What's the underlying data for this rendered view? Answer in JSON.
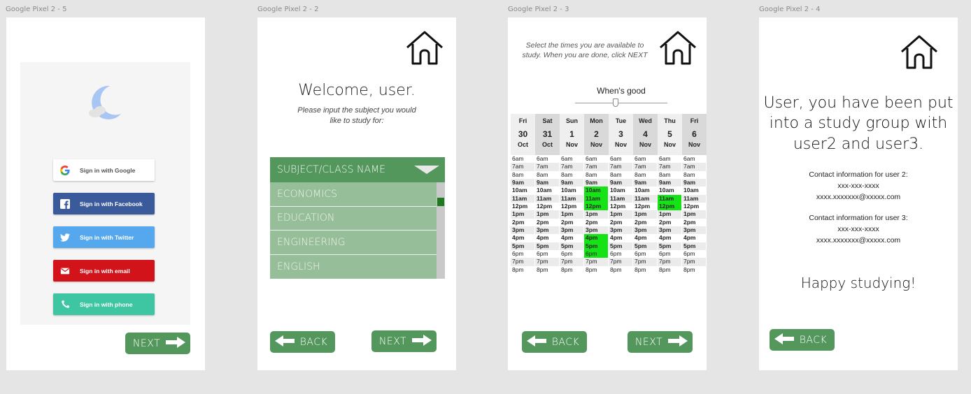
{
  "frames": [
    {
      "label": "Google Pixel 2 - 5"
    },
    {
      "label": "Google Pixel 2 - 2"
    },
    {
      "label": "Google Pixel 2 - 3"
    },
    {
      "label": "Google Pixel 2 - 4"
    }
  ],
  "login": {
    "buttons": [
      {
        "label": "Sign in with Google",
        "icon": "google-icon",
        "color": "#ffffff"
      },
      {
        "label": "Sign in with Facebook",
        "icon": "facebook-icon",
        "color": "#3b5a9b"
      },
      {
        "label": "Sign in with Twitter",
        "icon": "twitter-icon",
        "color": "#56a8ee"
      },
      {
        "label": "Sign in with email",
        "icon": "email-icon",
        "color": "#d2141a"
      },
      {
        "label": "Sign in with phone",
        "icon": "phone-icon",
        "color": "#3ec5a2"
      }
    ],
    "next_label": "NEXT"
  },
  "subject": {
    "title": "Welcome, user.",
    "subtitle": "Please input the subject you would like to study for:",
    "dropdown_selected": "SUBJECT/CLASS NAME",
    "options": [
      "ECONOMICS",
      "EDUCATION",
      "ENGINEERING",
      "ENGLISH"
    ],
    "back_label": "BACK",
    "next_label": "NEXT"
  },
  "schedule": {
    "instructions": "Select the times you are available to study. When you are done, click NEXT",
    "slider_label": "When's good",
    "days": [
      {
        "day": "Fri",
        "num": "30",
        "month": "Oct"
      },
      {
        "day": "Sat",
        "num": "31",
        "month": "Oct"
      },
      {
        "day": "Sun",
        "num": "1",
        "month": "Nov"
      },
      {
        "day": "Mon",
        "num": "2",
        "month": "Nov"
      },
      {
        "day": "Tue",
        "num": "3",
        "month": "Nov"
      },
      {
        "day": "Wed",
        "num": "4",
        "month": "Nov"
      },
      {
        "day": "Thu",
        "num": "5",
        "month": "Nov"
      },
      {
        "day": "Fri",
        "num": "6",
        "month": "Nov"
      }
    ],
    "times": [
      "6am",
      "7am",
      "8am",
      "9am",
      "10am",
      "11am",
      "12pm",
      "1pm",
      "2pm",
      "3pm",
      "4pm",
      "5pm",
      "6pm",
      "7pm",
      "8pm"
    ],
    "bold_times": [
      "9am",
      "10am",
      "11am",
      "12pm",
      "1pm",
      "2pm",
      "3pm",
      "4pm",
      "5pm"
    ],
    "selected": [
      {
        "day_index": 3,
        "time": "10am"
      },
      {
        "day_index": 3,
        "time": "11am"
      },
      {
        "day_index": 3,
        "time": "12pm"
      },
      {
        "day_index": 3,
        "time": "4pm"
      },
      {
        "day_index": 3,
        "time": "5pm"
      },
      {
        "day_index": 3,
        "time": "6pm"
      },
      {
        "day_index": 6,
        "time": "11am"
      },
      {
        "day_index": 6,
        "time": "12pm"
      }
    ],
    "selected_color": "#16e316",
    "back_label": "BACK",
    "next_label": "NEXT"
  },
  "group": {
    "message": "User, you have been put into a study group with user2 and user3.",
    "contact2_title": "Contact information for user 2:",
    "contact2_phone": "xxx-xxx-xxxx",
    "contact2_email": "xxxx.xxxxxxx@xxxxx.com",
    "contact3_title": "Contact information for user 3:",
    "contact3_phone": "xxx-xxx-xxxx",
    "contact3_email": "xxxx.xxxxxxx@xxxxx.com",
    "closing": "Happy studying!",
    "back_label": "BACK"
  },
  "colors": {
    "accent_green": "#53975c",
    "list_green": "#96be98"
  }
}
